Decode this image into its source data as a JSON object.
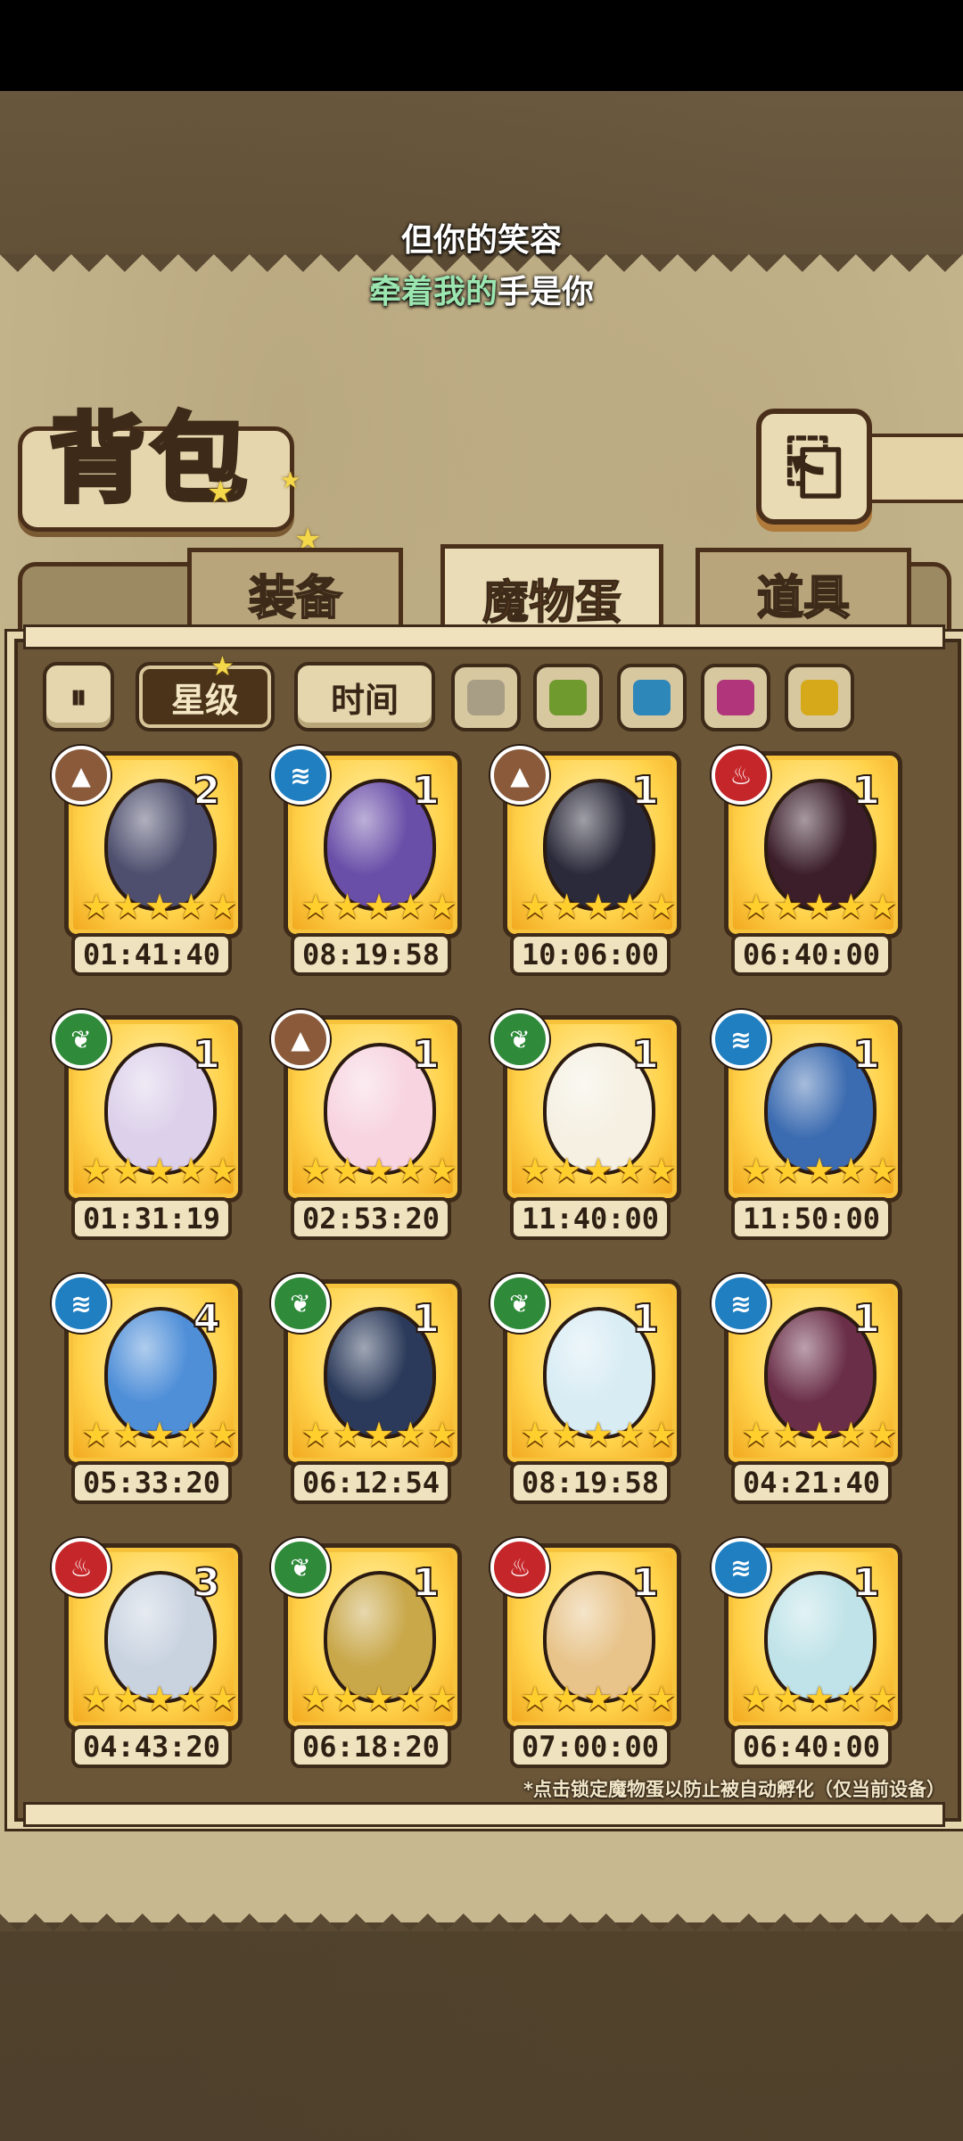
{
  "lyrics": {
    "line1": "但你的笑容",
    "line2_highlight": "牵着我的",
    "line2_rest": "手是你"
  },
  "title": "背包",
  "back_icon_glyph": "⎗",
  "tabs": [
    {
      "label": "装备",
      "active": false
    },
    {
      "label": "魔物蛋",
      "active": true
    },
    {
      "label": "道具",
      "active": false
    }
  ],
  "filters": {
    "sort_icon_glyph": "⏸",
    "star_label": "星级",
    "time_label": "时间"
  },
  "color_filters": [
    "#a89e86",
    "#6f9a2e",
    "#2d87b8",
    "#b0357a",
    "#d6a91a"
  ],
  "element_colors": {
    "earth": "#8a5a3a",
    "water": "#1f7fc0",
    "fire": "#c5262a",
    "leaf": "#2f8a3a"
  },
  "star_glyph": "★",
  "eggs": [
    {
      "element": "earth",
      "count": "2",
      "timer": "01:41:40",
      "color": "#4e4f6e"
    },
    {
      "element": "water",
      "count": "1",
      "timer": "08:19:58",
      "color": "#6a4fa8"
    },
    {
      "element": "earth",
      "count": "1",
      "timer": "10:06:00",
      "color": "#2b2a3a"
    },
    {
      "element": "fire",
      "count": "1",
      "timer": "06:40:00",
      "color": "#3b1e2a"
    },
    {
      "element": "leaf",
      "count": "1",
      "timer": "01:31:19",
      "color": "#dcd0ea"
    },
    {
      "element": "earth",
      "count": "1",
      "timer": "02:53:20",
      "color": "#f7d4e0"
    },
    {
      "element": "leaf",
      "count": "1",
      "timer": "11:40:00",
      "color": "#f5f0e2"
    },
    {
      "element": "water",
      "count": "1",
      "timer": "11:50:00",
      "color": "#3b6bb0"
    },
    {
      "element": "water",
      "count": "4",
      "timer": "05:33:20",
      "color": "#4f8fd8"
    },
    {
      "element": "leaf",
      "count": "1",
      "timer": "06:12:54",
      "color": "#2b3a5a"
    },
    {
      "element": "leaf",
      "count": "1",
      "timer": "08:19:58",
      "color": "#d8ecf4"
    },
    {
      "element": "water",
      "count": "1",
      "timer": "04:21:40",
      "color": "#6a2e48"
    },
    {
      "element": "fire",
      "count": "3",
      "timer": "04:43:20",
      "color": "#c9d3e0"
    },
    {
      "element": "leaf",
      "count": "1",
      "timer": "06:18:20",
      "color": "#c9a84a"
    },
    {
      "element": "fire",
      "count": "1",
      "timer": "07:00:00",
      "color": "#e8c48a"
    },
    {
      "element": "water",
      "count": "1",
      "timer": "06:40:00",
      "color": "#bfe3e8"
    }
  ],
  "note": "*点击锁定魔物蛋以防止被自动孵化（仅当前设备）"
}
